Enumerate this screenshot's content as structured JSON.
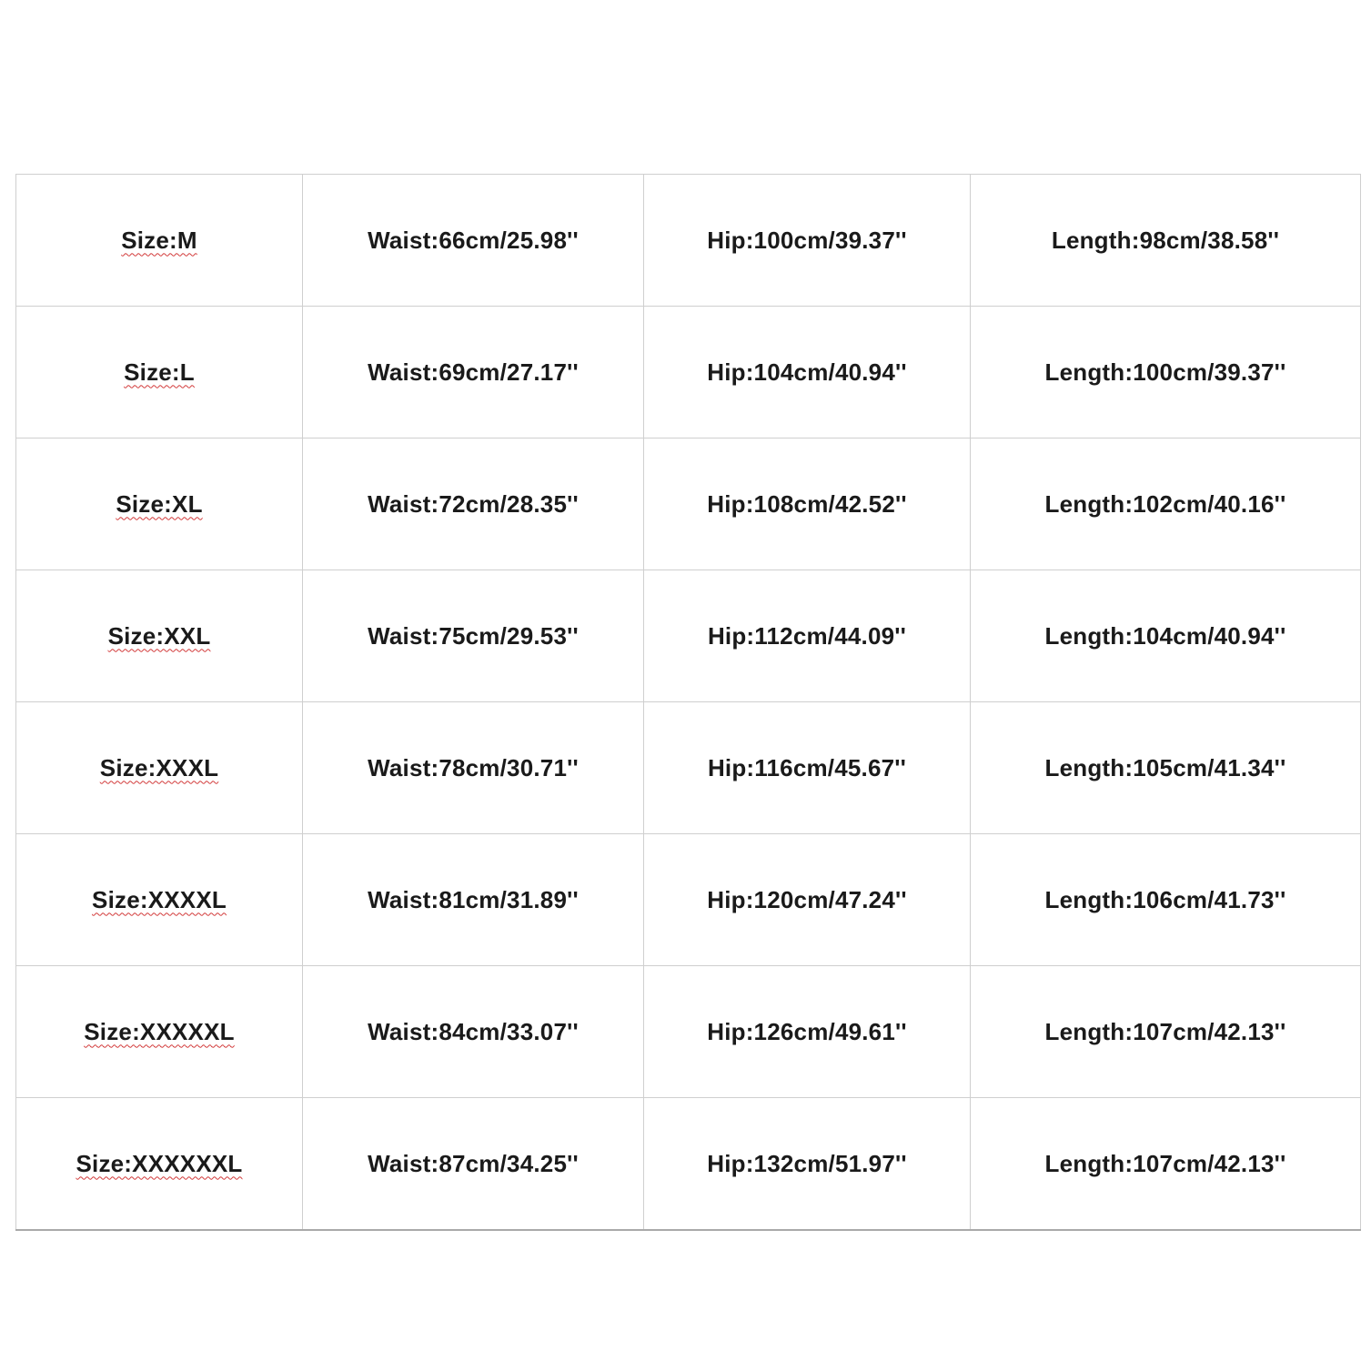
{
  "size_chart": {
    "rows": [
      {
        "size": "Size:M",
        "waist": "Waist:66cm/25.98''",
        "hip": "Hip:100cm/39.37''",
        "length": "Length:98cm/38.58''"
      },
      {
        "size": "Size:L",
        "waist": "Waist:69cm/27.17''",
        "hip": "Hip:104cm/40.94''",
        "length": "Length:100cm/39.37''"
      },
      {
        "size": "Size:XL",
        "waist": "Waist:72cm/28.35''",
        "hip": "Hip:108cm/42.52''",
        "length": "Length:102cm/40.16''"
      },
      {
        "size": "Size:XXL",
        "waist": "Waist:75cm/29.53''",
        "hip": "Hip:112cm/44.09''",
        "length": "Length:104cm/40.94''"
      },
      {
        "size": "Size:XXXL",
        "waist": "Waist:78cm/30.71''",
        "hip": "Hip:116cm/45.67''",
        "length": "Length:105cm/41.34''"
      },
      {
        "size": "Size:XXXXL",
        "waist": "Waist:81cm/31.89''",
        "hip": "Hip:120cm/47.24''",
        "length": "Length:106cm/41.73''"
      },
      {
        "size": "Size:XXXXXL",
        "waist": "Waist:84cm/33.07''",
        "hip": "Hip:126cm/49.61''",
        "length": "Length:107cm/42.13''"
      },
      {
        "size": "Size:XXXXXXL",
        "waist": "Waist:87cm/34.25''",
        "hip": "Hip:132cm/51.97''",
        "length": "Length:107cm/42.13''"
      }
    ]
  },
  "colors": {
    "background": "#ffffff",
    "text": "#1a1a1a",
    "grid_line": "#cfcfcf",
    "spellcheck_underline": "#d23a3a"
  }
}
